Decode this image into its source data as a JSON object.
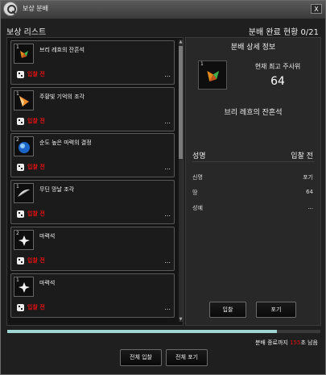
{
  "window": {
    "title": "보상 분배",
    "close_label": "X"
  },
  "header": {
    "left": "보상 리스트",
    "right": "분배 완료 현황 0/21"
  },
  "list": {
    "items": [
      {
        "count": "1",
        "name": "브리 레흐의 잔흔석",
        "status": "입찰 전",
        "more": "...",
        "icon": "orange-green-crystal-icon"
      },
      {
        "count": "1",
        "name": "주황빛 기억의 조각",
        "status": "입찰 전",
        "more": "...",
        "icon": "orange-shard-icon"
      },
      {
        "count": "2",
        "name": "순도 높은 마력의 결정",
        "status": "입찰 전",
        "more": "...",
        "icon": "blue-orb-icon"
      },
      {
        "count": "1",
        "name": "무딘 망날 조각",
        "status": "입찰 전",
        "more": "...",
        "icon": "feather-blade-icon"
      },
      {
        "count": "2",
        "name": "마력석",
        "status": "입찰 전",
        "more": "...",
        "icon": "white-star-gem-icon"
      },
      {
        "count": "1",
        "name": "마력석",
        "status": "입찰 전",
        "more": "...",
        "icon": "white-star-gem-icon"
      }
    ]
  },
  "detail": {
    "title": "분배 상세 정보",
    "count": "1",
    "label_top_roll": "현재 최고 주사위",
    "top_roll": "64",
    "item_name": "브리 레흐의 잔흔석",
    "section_left": "성명",
    "section_right": "입찰 전",
    "rows": [
      {
        "left": "신명",
        "right": "포기"
      },
      {
        "left": "땅",
        "right": "64"
      },
      {
        "left": "성예",
        "right": "..."
      }
    ],
    "bid_button": "입찰",
    "pass_button": "포기"
  },
  "progress": {
    "fraction": 0.86,
    "color": "#9fd6d1"
  },
  "timer": {
    "prefix": "분배 종료까지 ",
    "seconds": "155",
    "suffix": "초 남음"
  },
  "footer": {
    "bid_all": "전체 입찰",
    "pass_all": "전체 포기"
  }
}
